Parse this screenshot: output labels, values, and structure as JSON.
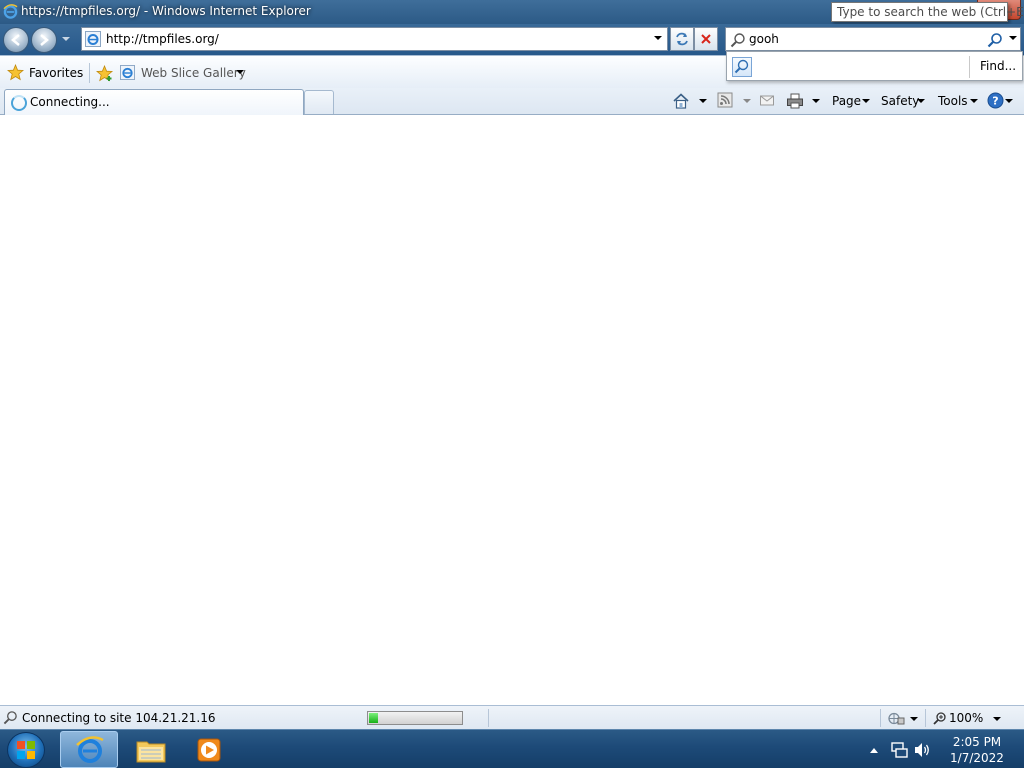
{
  "window": {
    "title": "https://tmpfiles.org/ - Windows Internet Explorer"
  },
  "tooltip": {
    "text": "Type to search the web (Ctrl+E)"
  },
  "navbar": {
    "address_url": "http://tmpfiles.org/",
    "search_value": "gooh"
  },
  "search_suggest": {
    "find_label": "Find..."
  },
  "favorites_bar": {
    "favorites_label": "Favorites",
    "web_slice_label": "Web Slice Gallery"
  },
  "tabs": [
    {
      "label": "Connecting...",
      "active": true
    }
  ],
  "command_bar": {
    "page_label": "Page",
    "safety_label": "Safety",
    "tools_label": "Tools"
  },
  "status_bar": {
    "status_text": "Connecting to site 104.21.21.16",
    "progress_fraction": 0.1,
    "zoom_label": "100%"
  },
  "taskbar": {
    "time": "2:05 PM",
    "date": "1/7/2022"
  },
  "colors": {
    "title_bar": "#2c5a86",
    "taskbar": "#1d4a78",
    "progress_fill": "#16b016",
    "close_button": "#c4462e"
  }
}
